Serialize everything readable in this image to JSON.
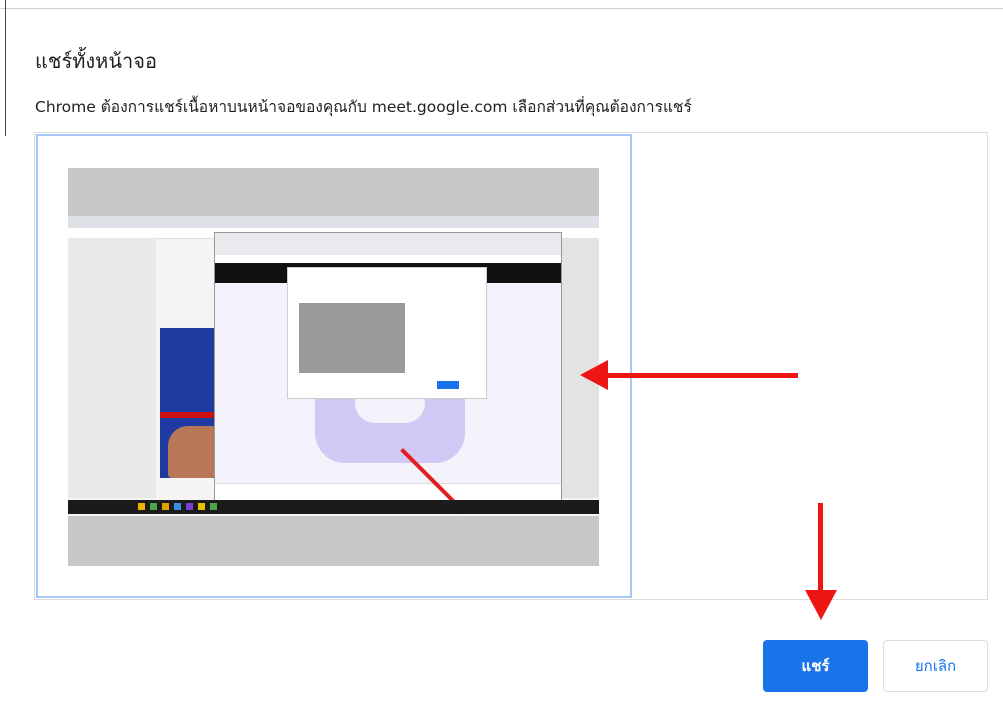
{
  "dialog": {
    "title": "แชร์ทั้งหน้าจอ",
    "subtitle": "Chrome ต้องการแชร์เนื้อหาบนหน้าจอของคุณกับ meet.google.com เลือกส่วนที่คุณต้องการแชร์",
    "share_label": "แชร์",
    "cancel_label": "ยกเลิก"
  },
  "colors": {
    "accent": "#1a73e8",
    "annotation_arrow": "#ee1515",
    "selection_border": "#a8c7fa"
  },
  "icons": [
    "screen-thumbnail"
  ]
}
